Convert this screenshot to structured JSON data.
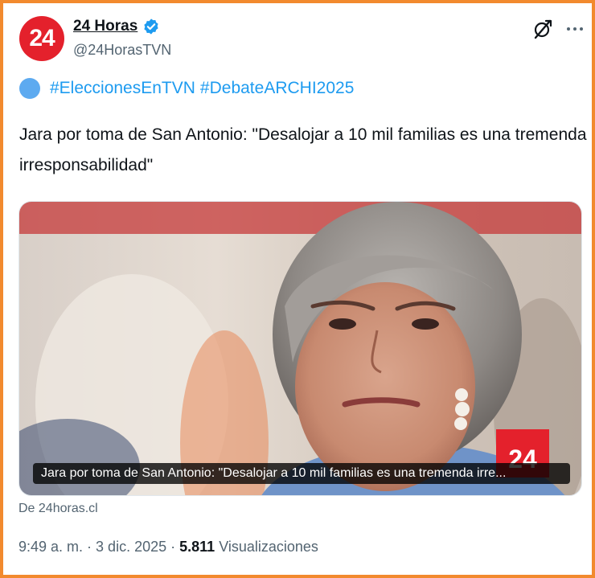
{
  "account": {
    "avatar_text": "24",
    "display_name": "24 Horas",
    "handle": "@24HorasTVN",
    "verified": true
  },
  "icons": {
    "verified": "verified-badge-icon",
    "grok": "grok-icon",
    "more": "more-options-icon",
    "circle": "blue-circle-emoji"
  },
  "tweet": {
    "hashtags": [
      "#EleccionesEnTVN",
      "#DebateARCHI2025"
    ],
    "text": "Jara por toma de San Antonio: \"Desalojar a 10 mil familias es una tremenda irresponsabilidad\""
  },
  "media": {
    "logo_text": "24",
    "caption": "Jara por toma de San Antonio: \"Desalojar a 10 mil familias es una tremenda irre..."
  },
  "source": "De 24horas.cl",
  "meta": {
    "time": "9:49 a. m.",
    "sep1": "·",
    "date": "3 dic. 2025",
    "sep2": "·",
    "views": "5.811",
    "views_label": "Visualizaciones"
  },
  "colors": {
    "frame_border": "#f28a2e",
    "brand_red": "#e4212c",
    "link_blue": "#1d9bf0",
    "secondary_text": "#536471"
  }
}
